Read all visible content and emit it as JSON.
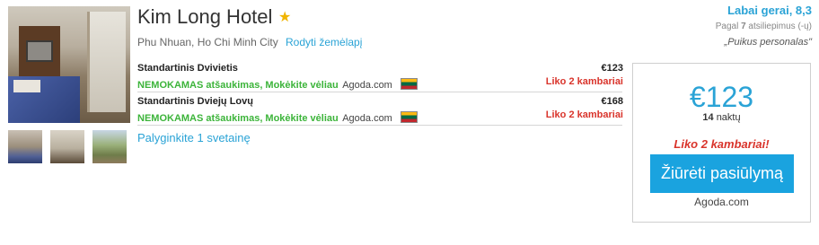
{
  "hotel": {
    "name": "Kim Long Hotel",
    "star_icon": "star-icon",
    "address": "Phu Nhuan, Ho Chi Minh City",
    "map_link": "Rodyti žemėlapį"
  },
  "rates": [
    {
      "room": "Standartinis Dvivietis",
      "cancellation": "NEMOKAMAS atšaukimas, Mokėkite vėliau",
      "provider": "Agoda.com",
      "price": "€123",
      "rooms_left": "Liko 2 kambariai"
    },
    {
      "room": "Standartinis Dviejų Lovų",
      "cancellation": "NEMOKAMAS atšaukimas, Mokėkite vėliau",
      "provider": "Agoda.com",
      "price": "€168",
      "rooms_left": "Liko 2 kambariai"
    }
  ],
  "compare_link": "Palyginkite 1 svetainę",
  "review": {
    "rating": "Labai gerai, 8,3",
    "count_prefix": "Pagal",
    "count": "7",
    "count_suffix": "atsiliepimus (-ų)",
    "quote": "„Puikus personalas\""
  },
  "deal": {
    "price": "€123",
    "nights_count": "14",
    "nights_label": "naktų",
    "rooms_left": "Liko 2 kambariai!",
    "cta_label": "Žiūrėti pasiūlymą",
    "provider": "Agoda.com"
  },
  "colors": {
    "accent": "#2aa3d6",
    "cta": "#1aa3df",
    "free_green": "#3cb43a",
    "warning_red": "#d9342b",
    "star": "#f0b400"
  }
}
